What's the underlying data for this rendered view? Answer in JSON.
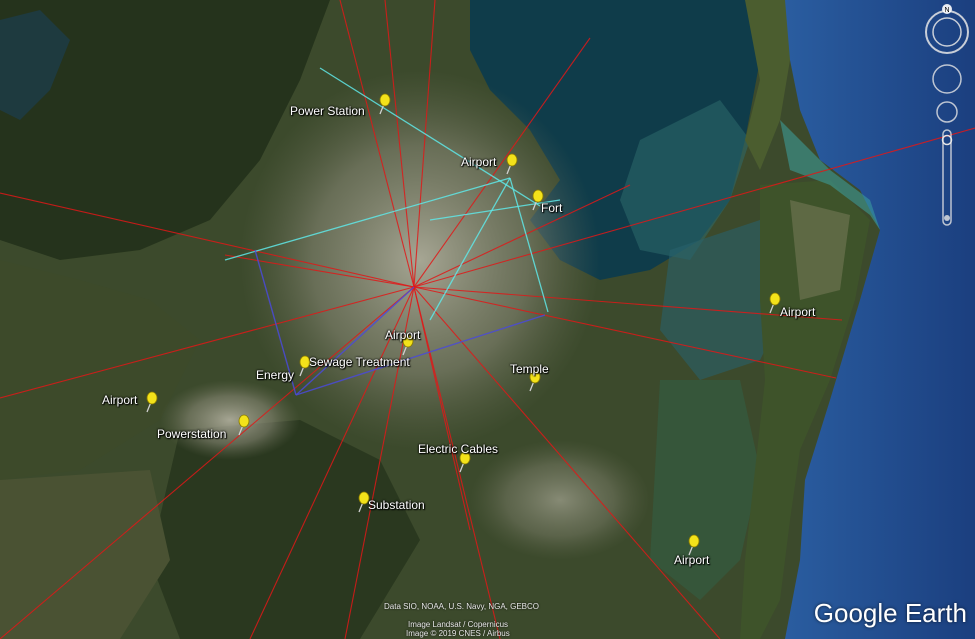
{
  "app": {
    "brand": "Google Earth",
    "attribution": {
      "line1": "Data SIO, NOAA, U.S. Navy, NGA, GEBCO",
      "line2": "Image Landsat / Copernicus",
      "line3": "Image © 2019 CNES / Airbus"
    }
  },
  "navigation": {
    "compass_label": "N",
    "icons": [
      "compass-icon",
      "look-joystick-icon",
      "move-joystick-icon",
      "zoom-slider-icon"
    ]
  },
  "placemarks": [
    {
      "id": "power-station",
      "label": "Power Station"
    },
    {
      "id": "airport-north",
      "label": "Airport"
    },
    {
      "id": "fort",
      "label": "Fort"
    },
    {
      "id": "airport-island",
      "label": "Airport"
    },
    {
      "id": "airport-central",
      "label": "Airport"
    },
    {
      "id": "sewage-treatment",
      "label": "Sewage Treatment"
    },
    {
      "id": "energy",
      "label": "Energy"
    },
    {
      "id": "temple",
      "label": "Temple"
    },
    {
      "id": "airport-west",
      "label": "Airport"
    },
    {
      "id": "powerstation",
      "label": "Powerstation"
    },
    {
      "id": "electric-cables",
      "label": "Electric Cables"
    },
    {
      "id": "substation",
      "label": "Substation"
    },
    {
      "id": "airport-south",
      "label": "Airport"
    }
  ],
  "colors": {
    "radial_lines": "#e01818",
    "cyan_lines": "#5fe8e8",
    "blue_lines": "#4a4ad8",
    "pin": "#f3e21a",
    "ocean": "#1d4a8c",
    "bay": "#0f3a4a"
  }
}
